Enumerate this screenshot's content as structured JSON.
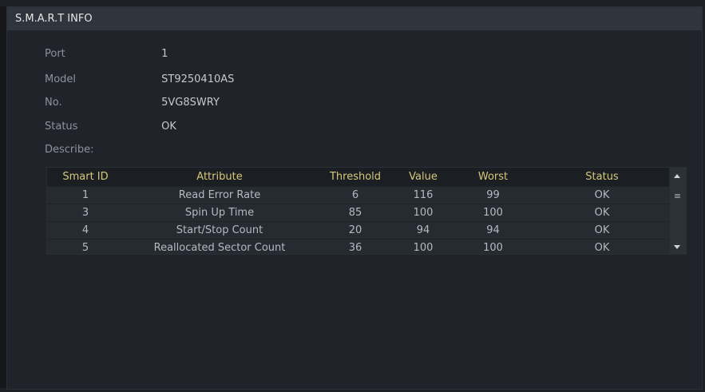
{
  "window": {
    "title": "S.M.A.R.T INFO"
  },
  "info": [
    {
      "label": "Port",
      "value": "1"
    },
    {
      "label": "Model",
      "value": "ST9250410AS"
    },
    {
      "label": "No.",
      "value": "5VG8SWRY"
    },
    {
      "label": "Status",
      "value": "OK"
    },
    {
      "label": "Describe:",
      "value": ""
    }
  ],
  "table": {
    "headers": [
      "Smart ID",
      "Attribute",
      "Threshold",
      "Value",
      "Worst",
      "Status"
    ],
    "rows": [
      [
        "1",
        "Read Error Rate",
        "6",
        "116",
        "99",
        "OK"
      ],
      [
        "3",
        "Spin Up Time",
        "85",
        "100",
        "100",
        "OK"
      ],
      [
        "4",
        "Start/Stop Count",
        "20",
        "94",
        "94",
        "OK"
      ],
      [
        "5",
        "Reallocated Sector Count",
        "36",
        "100",
        "100",
        "OK"
      ]
    ]
  },
  "scrollbar": {
    "up_icon": "triangle-up",
    "thumb_icon": "grip-lines",
    "down_icon": "triangle-down"
  },
  "colors": {
    "background": "#202329",
    "header_text": "#d6c87a",
    "titlebar": "#30343c"
  }
}
